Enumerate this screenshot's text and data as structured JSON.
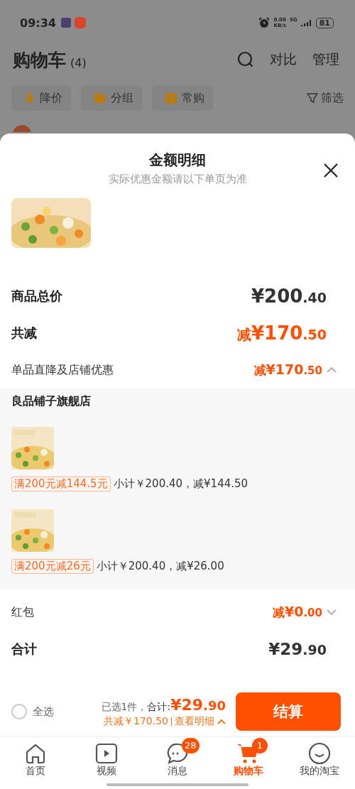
{
  "status_bar": {
    "time": "09:34",
    "net_speed": "0.00",
    "net_unit": "KB/s",
    "network": "5G",
    "battery": "81"
  },
  "header": {
    "title": "购物车",
    "count": "(4)",
    "actions": [
      "对比",
      "管理"
    ]
  },
  "chips": [
    {
      "label": "降价",
      "kind": "price-drop"
    },
    {
      "label": "分组",
      "kind": "folder"
    },
    {
      "label": "常购",
      "kind": "bag"
    }
  ],
  "filter": "筛选",
  "sheet": {
    "title": "金额明细",
    "subtitle": "实际优惠金额请以下单页为准",
    "total": {
      "label": "商品总价",
      "amount": "¥200.40"
    },
    "discount": {
      "label": "共减",
      "prefix": "减",
      "amount": "¥170.50"
    },
    "store_discount": {
      "label": "单品直降及店铺优惠",
      "prefix": "减",
      "amount": "¥170.50",
      "expanded": true
    },
    "store": {
      "name": "良品铺子旗舰店",
      "items": [
        {
          "tag": "满200元减144.5元",
          "subtotal": "小计￥200.40，减¥144.50"
        },
        {
          "tag": "满200元减26元",
          "subtotal": "小计￥200.40，减¥26.00"
        }
      ]
    },
    "red_packet": {
      "label": "红包",
      "prefix": "减",
      "amount": "¥0.00",
      "expanded": false
    },
    "sum": {
      "label": "合计",
      "amount": "¥29.90"
    }
  },
  "footer": {
    "select_all": {
      "label": "全选",
      "checked": false
    },
    "selected": "已选1件，",
    "total_label": "合计:",
    "total": "¥29.90",
    "discount": "共减￥170.50",
    "detail_link": "查看明细",
    "checkout": "结算"
  },
  "tabs": [
    {
      "label": "首页",
      "kind": "home",
      "selected": false
    },
    {
      "label": "视频",
      "kind": "video",
      "selected": false
    },
    {
      "label": "消息",
      "kind": "chat",
      "selected": false,
      "badge": "28"
    },
    {
      "label": "购物车",
      "kind": "cart",
      "selected": true,
      "badge": "1"
    },
    {
      "label": "我的淘宝",
      "kind": "face",
      "selected": false
    }
  ]
}
